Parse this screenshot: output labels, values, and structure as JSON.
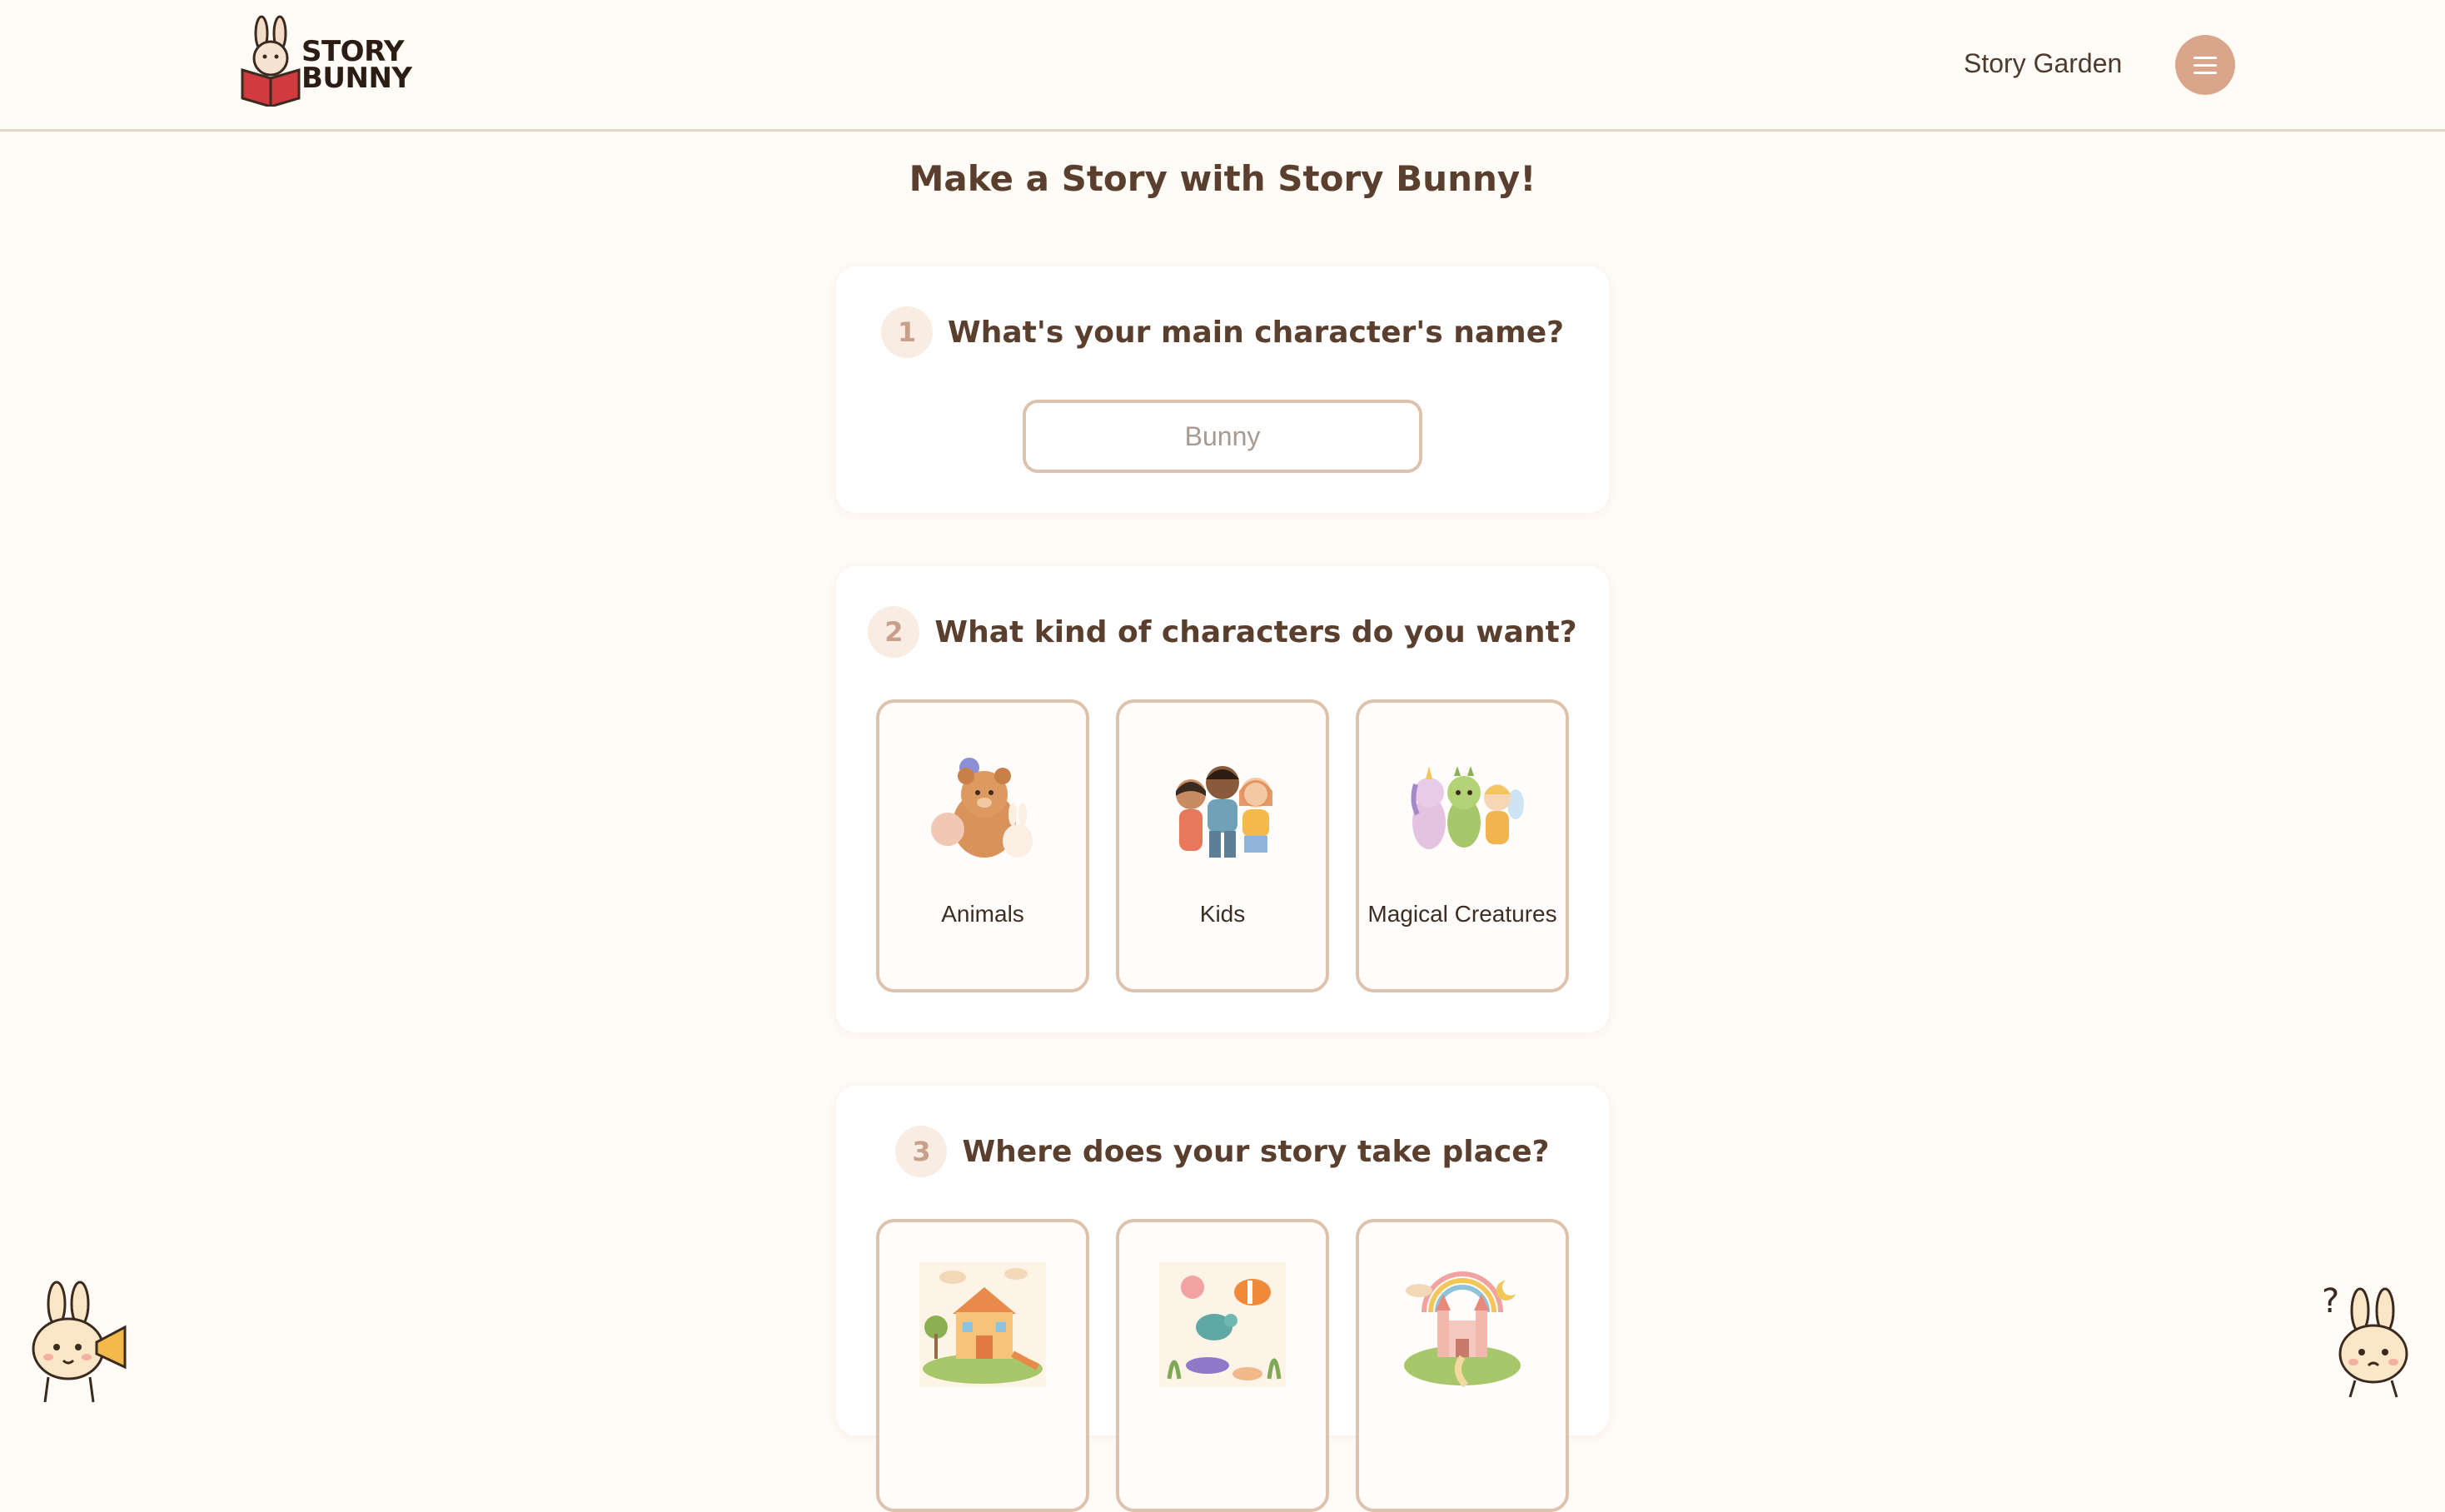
{
  "header": {
    "logo_line1": "STORY",
    "logo_line2": "BUNNY",
    "nav_link": "Story Garden",
    "menu_icon": "hamburger-icon"
  },
  "page": {
    "title": "Make a Story with Story Bunny!"
  },
  "steps": [
    {
      "number": "1",
      "question": "What's your main character's name?",
      "input_placeholder": "Bunny"
    },
    {
      "number": "2",
      "question": "What kind of characters do you want?",
      "options": [
        "Animals",
        "Kids",
        "Magical Creatures"
      ]
    },
    {
      "number": "3",
      "question": "Where does your story take place?",
      "options": [
        "",
        "",
        ""
      ]
    }
  ],
  "colors": {
    "background": "#fffbf6",
    "accent": "#d9a68b",
    "tile_border": "#ddc2ad",
    "heading": "#5a3f2e"
  }
}
